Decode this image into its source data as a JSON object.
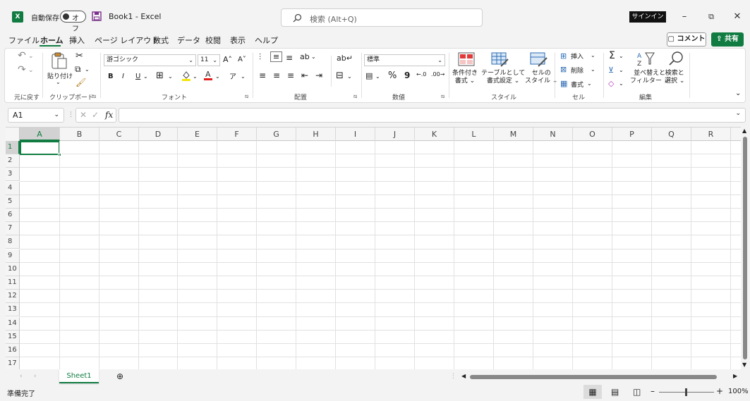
{
  "title_bar": {
    "app_icon": "X",
    "autosave_label": "自動保存",
    "autosave_state": "オフ",
    "file_title": "Book1  -  Excel",
    "search_placeholder": "検索 (Alt+Q)",
    "signin_label": "サインイン"
  },
  "menu": {
    "tabs": [
      "ファイル",
      "ホーム",
      "挿入",
      "ページ レイアウト",
      "数式",
      "データ",
      "校閲",
      "表示",
      "ヘルプ"
    ],
    "active_tab": "ホーム",
    "comment_label": "コメント",
    "share_label": "共有"
  },
  "ribbon": {
    "groups": {
      "undo": "元に戻す",
      "clipboard": "クリップボード",
      "font": "フォント",
      "alignment": "配置",
      "number": "数値",
      "styles": "スタイル",
      "cells": "セル",
      "editing": "編集"
    },
    "paste_label": "貼り付け",
    "font_name": "游ゴシック",
    "font_size": "11",
    "bold": "B",
    "italic": "I",
    "underline": "U",
    "number_format": "標準",
    "percent": "%",
    "comma": "9",
    "conditional_format": [
      "条件付き",
      "書式 ⌄"
    ],
    "format_as_table": [
      "テーブルとして",
      "書式設定 ⌄"
    ],
    "cell_styles": [
      "セルの",
      "スタイル ⌄"
    ],
    "insert_label": "挿入",
    "delete_label": "削除",
    "format_label": "書式",
    "sort_filter": [
      "並べ替えと",
      "フィルター ⌄"
    ],
    "find_select": [
      "検索と",
      "選択 ⌄"
    ]
  },
  "formula_bar": {
    "name_box": "A1",
    "fx": "fx",
    "formula": ""
  },
  "grid": {
    "columns": [
      "A",
      "B",
      "C",
      "D",
      "E",
      "F",
      "G",
      "H",
      "I",
      "J",
      "K",
      "L",
      "M",
      "N",
      "O",
      "P",
      "Q",
      "R"
    ],
    "rows": [
      "1",
      "2",
      "3",
      "4",
      "5",
      "6",
      "7",
      "8",
      "9",
      "10",
      "11",
      "12",
      "13",
      "14",
      "15",
      "16",
      "17"
    ],
    "selected_cell": "A1"
  },
  "sheets": {
    "tabs": [
      "Sheet1"
    ],
    "active": "Sheet1"
  },
  "status_bar": {
    "status": "準備完了",
    "zoom": "100%"
  },
  "colors": {
    "accent": "#107c41"
  }
}
